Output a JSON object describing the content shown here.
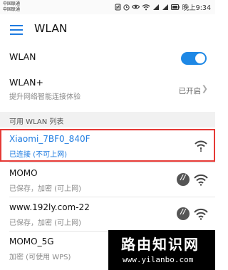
{
  "status_bar": {
    "carrier_1": "中国联通",
    "carrier_2": "中国联通",
    "time": "晚上9:34"
  },
  "header": {
    "title": "WLAN"
  },
  "wlan": {
    "label": "WLAN",
    "enabled": true
  },
  "wlan_plus": {
    "label": "WLAN+",
    "subtitle": "提升网络智能连接体验",
    "status": "已开启"
  },
  "available": {
    "section_title": "可用 WLAN 列表",
    "networks": [
      {
        "ssid": "Xiaomi_7BF0_840F",
        "status": "已连接 (不可上网)",
        "hotspot_icon": false,
        "signal_icon": "wifi-signal-warning-icon"
      },
      {
        "ssid": "MOMO",
        "status": "已保存，加密 (可上网)",
        "hotspot_icon": true,
        "signal_icon": "wifi-signal-icon"
      },
      {
        "ssid": "www.192ly.com-22",
        "status": "已保存，加密 (可上网)",
        "hotspot_icon": true,
        "signal_icon": "wifi-signal-icon"
      },
      {
        "ssid": "MOMO_5G",
        "status": "加密 (可使用 WPS)",
        "hotspot_icon": false,
        "signal_icon": "wifi-signal-icon"
      }
    ]
  },
  "watermark": {
    "title": "路由知识网",
    "url": "www.yilanbo.com"
  },
  "colors": {
    "accent": "#1e88e5",
    "highlight_border": "#e53935"
  }
}
